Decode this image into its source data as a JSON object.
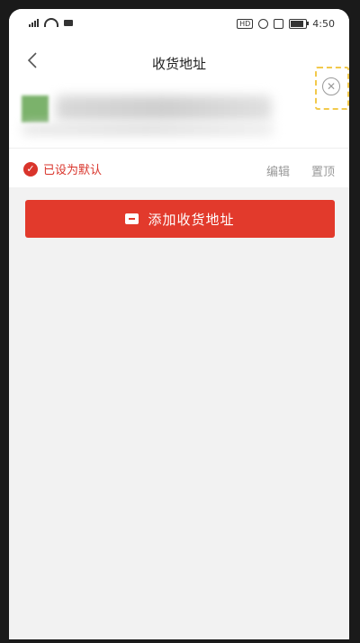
{
  "status_bar": {
    "time": "4:50",
    "battery_level": 0.85,
    "icons": [
      "signal-icon",
      "wifi-icon",
      "message-icon",
      "hd-icon",
      "alarm-icon",
      "vibrate-icon",
      "battery-icon"
    ]
  },
  "header": {
    "title": "收货地址",
    "back_icon": "chevron-left-icon"
  },
  "address_card": {
    "default_label": "已设为默认",
    "edit_label": "编辑",
    "pin_label": "置顶",
    "close_icon": "close-icon"
  },
  "actions": {
    "add_address_label": "添加收货地址",
    "add_icon": "add-address-icon"
  },
  "colors": {
    "accent": "#e23a2c",
    "default_red": "#d9342b",
    "background": "#f2f2f2"
  }
}
